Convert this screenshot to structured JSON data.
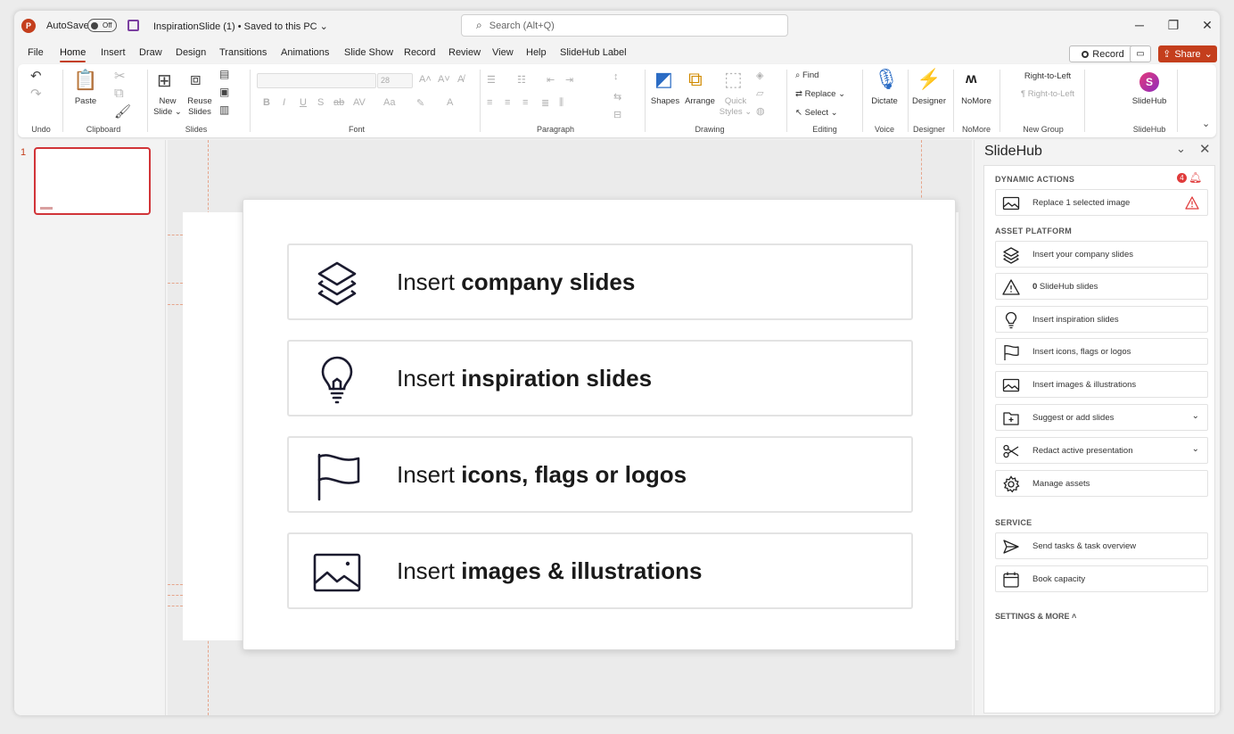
{
  "window": {
    "autosave_label": "AutoSave",
    "autosave_state": "Off",
    "doc_title": "InspirationSlide (1)  •  Saved to this PC ⌄",
    "search_placeholder": "Search (Alt+Q)",
    "app_logo": "P"
  },
  "menu": {
    "tabs": [
      "File",
      "Home",
      "Insert",
      "Draw",
      "Design",
      "Transitions",
      "Animations",
      "Slide Show",
      "Record",
      "Review",
      "View",
      "Help",
      "SlideHub Label"
    ],
    "active": "Home",
    "record_label": "Record",
    "share_label": "Share"
  },
  "ribbon": {
    "groups": {
      "undo": "Undo",
      "clipboard": "Clipboard",
      "slides": "Slides",
      "font": "Font",
      "paragraph": "Paragraph",
      "drawing": "Drawing",
      "editing": "Editing",
      "voice": "Voice",
      "designer": "Designer",
      "nomore": "NoMore",
      "new_group": "New Group",
      "slidehub": "SlideHub"
    },
    "buttons": {
      "paste": "Paste",
      "new_slide": "New\nSlide ⌄",
      "reuse_slides": "Reuse\nSlides",
      "font_size": "28",
      "shapes": "Shapes",
      "arrange": "Arrange",
      "quick_styles": "Quick\nStyles ⌄",
      "find": "Find",
      "replace": "Replace",
      "select": "Select ⌄",
      "dictate": "Dictate",
      "designer": "Designer",
      "nomore": "NoMore",
      "rtl": "Right-to-Left",
      "rtl2": "¶ Right-to-Left",
      "slidehub": "SlideHub",
      "slidehub_logo": "S"
    }
  },
  "thumbnails": {
    "number": "1"
  },
  "slide": {
    "cards": [
      {
        "prefix": "Insert ",
        "bold": "company slides",
        "icon": "layers-icon"
      },
      {
        "prefix": "Insert ",
        "bold": "inspiration slides",
        "icon": "lightbulb-icon"
      },
      {
        "prefix": "Insert ",
        "bold": "icons, flags or logos",
        "icon": "flag-icon"
      },
      {
        "prefix": "Insert ",
        "bold": "images & illustrations",
        "icon": "image-icon"
      }
    ]
  },
  "sidepane": {
    "title": "SlideHub",
    "notif_count": "4",
    "sections": {
      "dynamic": "DYNAMIC ACTIONS",
      "asset": "ASSET PLATFORM",
      "service": "SERVICE",
      "settings": "SETTINGS & MORE"
    },
    "items": {
      "replace": "Replace 1 selected image",
      "company": "Insert your company slides",
      "slidehub_count": "0",
      "slidehub_slides": " SlideHub slides",
      "inspiration": "Insert inspiration slides",
      "icons": "Insert icons, flags or logos",
      "images": "Insert images & illustrations",
      "suggest": "Suggest or add slides",
      "redact": "Redact active presentation",
      "manage": "Manage assets",
      "tasks": "Send tasks & task overview",
      "book": "Book capacity"
    }
  }
}
